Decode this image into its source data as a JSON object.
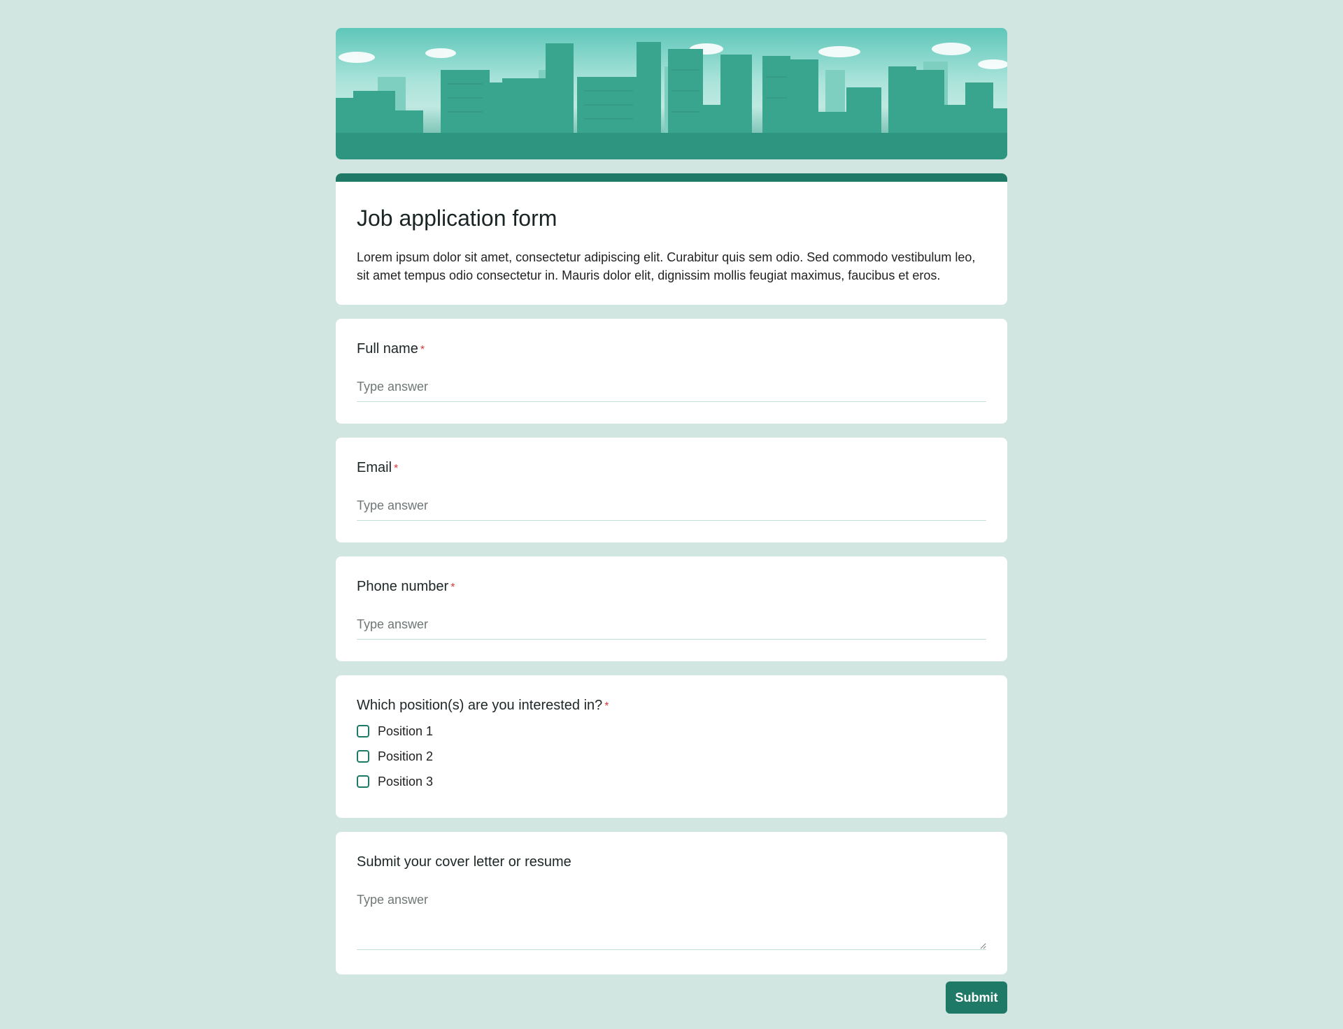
{
  "form": {
    "title": "Job application form",
    "description": "Lorem ipsum dolor sit amet, consectetur adipiscing elit. Curabitur quis sem odio. Sed commodo vestibulum leo, sit amet tempus odio consectetur in. Mauris dolor elit, dignissim mollis feugiat maximus, faucibus et eros."
  },
  "questions": {
    "full_name": {
      "label": "Full name",
      "required_mark": "*",
      "placeholder": "Type answer"
    },
    "email": {
      "label": "Email",
      "required_mark": "*",
      "placeholder": "Type answer"
    },
    "phone": {
      "label": "Phone number",
      "required_mark": "*",
      "placeholder": "Type answer"
    },
    "positions": {
      "label": "Which position(s) are you interested in?",
      "required_mark": "*",
      "options": [
        "Position 1",
        "Position 2",
        "Position 3"
      ]
    },
    "cover_letter": {
      "label": "Submit your cover letter or resume",
      "placeholder": "Type answer"
    }
  },
  "actions": {
    "submit_label": "Submit"
  },
  "colors": {
    "accent": "#1e7a66",
    "background": "#d1e6e1",
    "required": "#d93a3a"
  }
}
